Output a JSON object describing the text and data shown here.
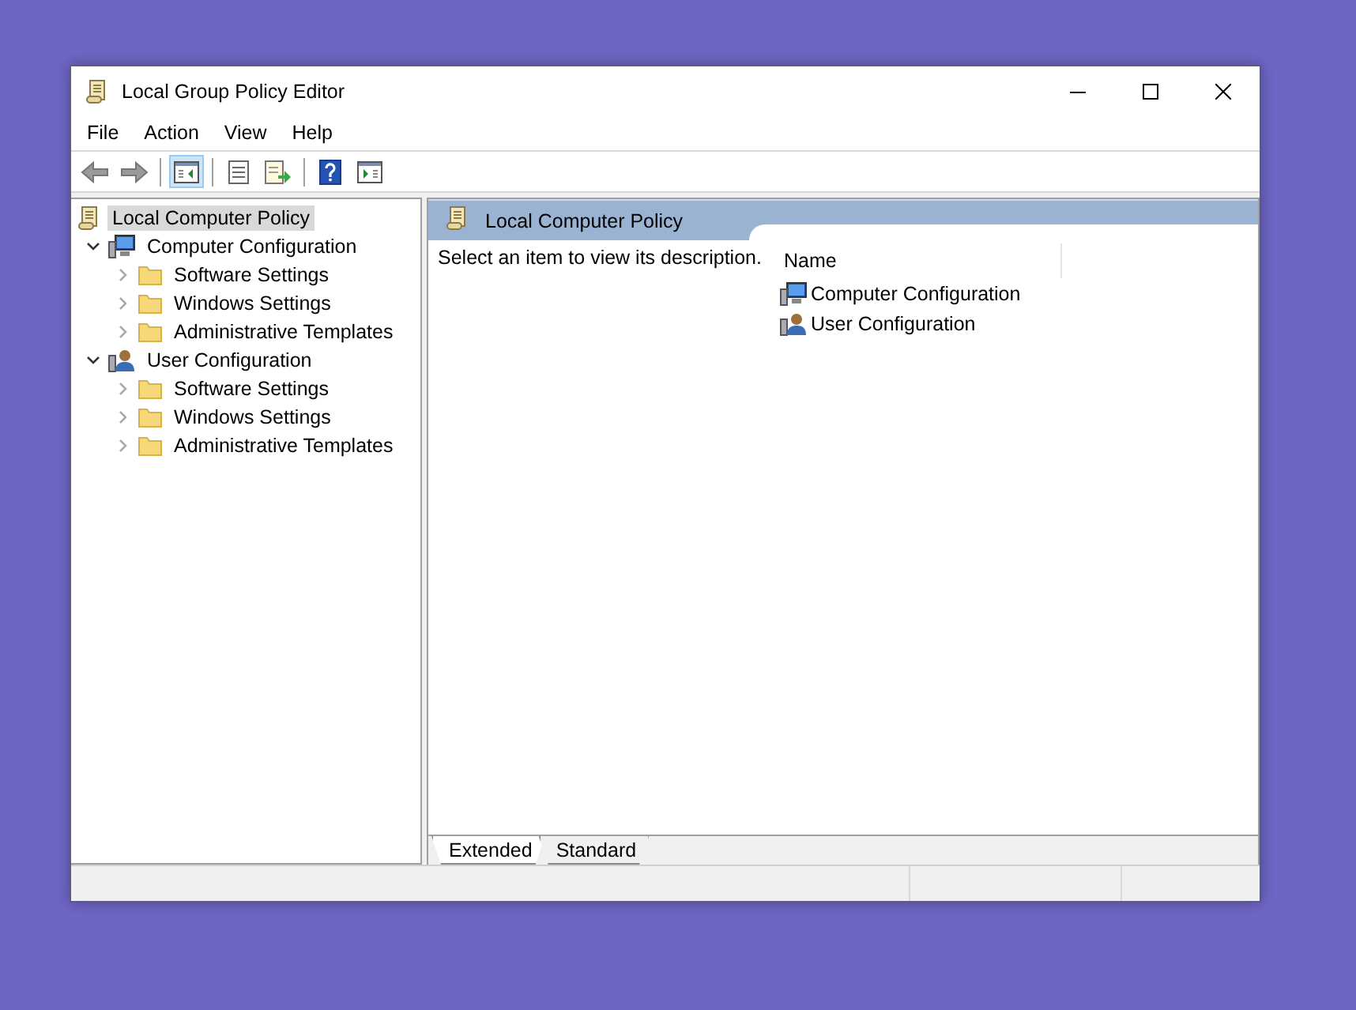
{
  "window": {
    "title": "Local Group Policy Editor"
  },
  "menu": [
    "File",
    "Action",
    "View",
    "Help"
  ],
  "toolbar": [
    {
      "kind": "back",
      "selected": false
    },
    {
      "kind": "forward",
      "selected": false
    },
    {
      "kind": "separator"
    },
    {
      "kind": "console-tree",
      "selected": true
    },
    {
      "kind": "separator"
    },
    {
      "kind": "properties",
      "selected": false
    },
    {
      "kind": "export",
      "selected": false
    },
    {
      "kind": "separator"
    },
    {
      "kind": "help",
      "selected": false
    },
    {
      "kind": "action-pane",
      "selected": false
    }
  ],
  "tree": [
    {
      "label": "Local Computer Policy",
      "kind": "policy",
      "selected": true,
      "children": [
        {
          "label": "Computer Configuration",
          "kind": "computer",
          "selected": false,
          "expanded": true,
          "children": [
            {
              "label": "Software Settings",
              "kind": "folder",
              "selected": false,
              "expanded": false
            },
            {
              "label": "Windows Settings",
              "kind": "folder",
              "selected": false,
              "expanded": false
            },
            {
              "label": "Administrative Templates",
              "kind": "folder",
              "selected": false,
              "expanded": false
            }
          ]
        },
        {
          "label": "User Configuration",
          "kind": "user",
          "selected": false,
          "expanded": true,
          "children": [
            {
              "label": "Software Settings",
              "kind": "folder",
              "selected": false,
              "expanded": false
            },
            {
              "label": "Windows Settings",
              "kind": "folder",
              "selected": false,
              "expanded": false
            },
            {
              "label": "Administrative Templates",
              "kind": "folder",
              "selected": false,
              "expanded": false
            }
          ]
        }
      ]
    }
  ],
  "detail": {
    "title": "Local Computer Policy",
    "description": "Select an item to view its description.",
    "column": "Name",
    "items": [
      {
        "label": "Computer Configuration",
        "kind": "computer"
      },
      {
        "label": "User Configuration",
        "kind": "user"
      }
    ]
  },
  "tabs": [
    {
      "label": "Extended",
      "selected": true
    },
    {
      "label": "Standard",
      "selected": false
    }
  ]
}
